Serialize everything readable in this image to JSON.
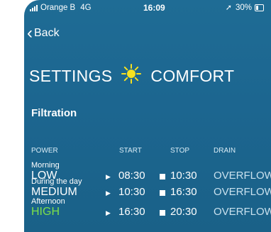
{
  "status_bar": {
    "carrier": "Orange B",
    "network": "4G",
    "time": "16:09",
    "battery": "30%",
    "battery_level": 0.3
  },
  "nav": {
    "back_label": "Back"
  },
  "header": {
    "title_left": "SETTINGS",
    "title_right": "COMFORT",
    "icon": "sun-icon",
    "sun_color": "#f7e11f"
  },
  "section": {
    "title": "Filtration"
  },
  "table": {
    "headers": {
      "power": "POWER",
      "start": "START",
      "stop": "STOP",
      "drain": "DRAIN"
    },
    "rows": [
      {
        "label": "Morning",
        "level": "LOW",
        "start": "08:30",
        "stop": "10:30",
        "drain": "OVERFLOW",
        "level_color": "#ffffff"
      },
      {
        "label": "During the day",
        "level": "MEDIUM",
        "start": "10:30",
        "stop": "16:30",
        "drain": "OVERFLOW",
        "level_color": "#ffffff"
      },
      {
        "label": "Afternoon",
        "level": "HIGH",
        "start": "16:30",
        "stop": "20:30",
        "drain": "OVERFLOW",
        "level_color": "#7de04a"
      }
    ]
  }
}
